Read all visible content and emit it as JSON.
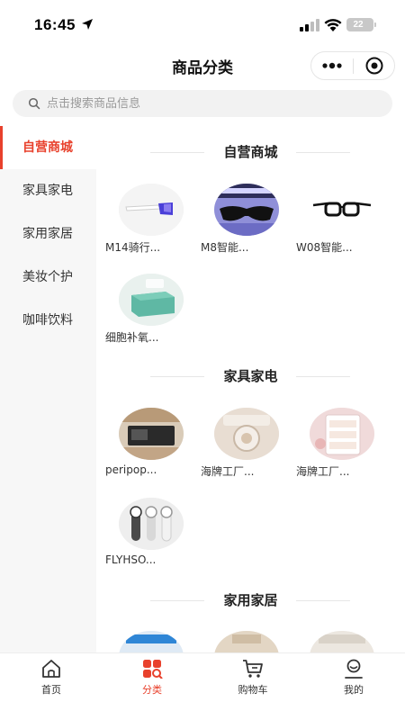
{
  "status_bar": {
    "time": "16:45",
    "battery": "22"
  },
  "header": {
    "title": "商品分类"
  },
  "search": {
    "placeholder": "点击搜索商品信息"
  },
  "sidebar": {
    "items": [
      {
        "label": "自营商城",
        "active": true
      },
      {
        "label": "家具家电",
        "active": false
      },
      {
        "label": "家用家居",
        "active": false
      },
      {
        "label": "美妆个护",
        "active": false
      },
      {
        "label": "咖啡饮料",
        "active": false
      }
    ]
  },
  "sections": [
    {
      "title": "自营商城",
      "products": [
        {
          "name": "M14骑行..."
        },
        {
          "name": "M8智能..."
        },
        {
          "name": "W08智能..."
        },
        {
          "name": "细胞补氧..."
        }
      ]
    },
    {
      "title": "家具家电",
      "products": [
        {
          "name": "peripop..."
        },
        {
          "name": "海牌工厂..."
        },
        {
          "name": "海牌工厂..."
        },
        {
          "name": "FLYHSO..."
        }
      ]
    },
    {
      "title": "家用家居",
      "products": [
        {
          "name": ""
        },
        {
          "name": ""
        },
        {
          "name": ""
        }
      ]
    }
  ],
  "tabbar": {
    "items": [
      {
        "label": "首页",
        "icon": "home-icon",
        "active": false
      },
      {
        "label": "分类",
        "icon": "category-icon",
        "active": true
      },
      {
        "label": "购物车",
        "icon": "cart-icon",
        "active": false
      },
      {
        "label": "我的",
        "icon": "profile-icon",
        "active": false
      }
    ]
  },
  "colors": {
    "accent": "#e8412c",
    "sidebar_bg": "#f7f7f7",
    "search_bg": "#f2f2f2"
  }
}
